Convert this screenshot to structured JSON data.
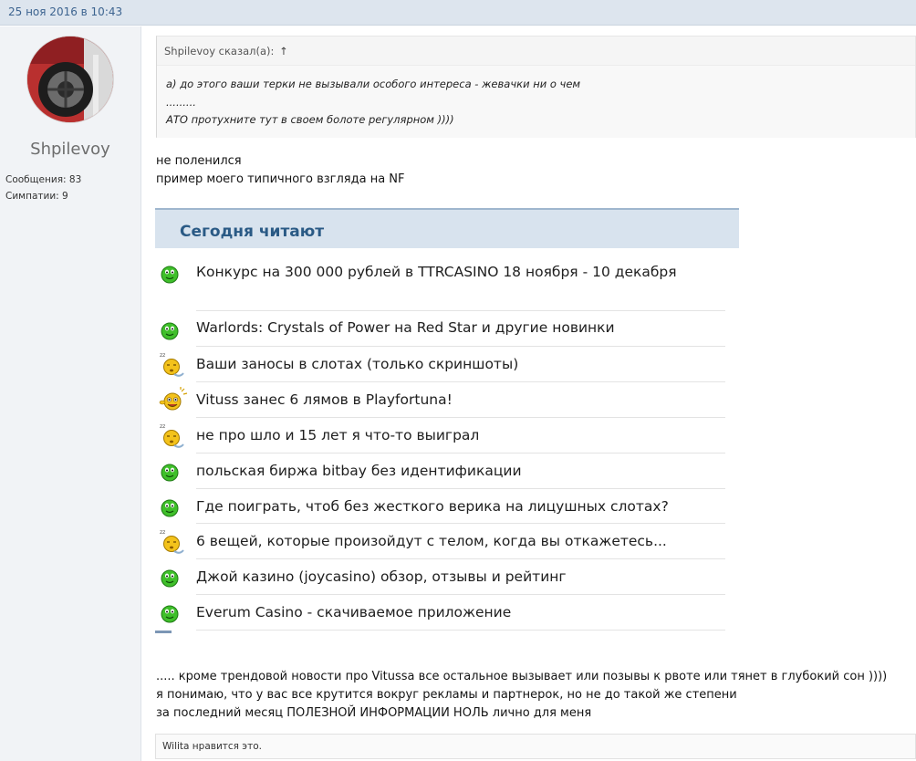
{
  "post": {
    "date": "25 ноя 2016 в 10:43"
  },
  "author": {
    "name": "Shpilevoy",
    "messages": "Сообщения: 83",
    "likes": "Симпатии: 9"
  },
  "quote": {
    "header": "Shpilevoy сказал(а):",
    "arrow": "↑",
    "lines": [
      "а) до этого ваши терки не вызывали особого интереса - жевачки ни о чем",
      ".........",
      "АТО протухните тут в своем болоте регулярном ))))"
    ]
  },
  "message": {
    "intro": [
      "не поленился",
      "пример моего типичного взгляда на NF"
    ],
    "outro": [
      "..... кроме трендовой новости про Vitussa все остальное вызывает или позывы к рвоте или тянет в глубокий сон ))))",
      "я понимаю, что у вас все крутится вокруг рекламы и партнерок, но не до такой же степени",
      "за последний месяц ПОЛЕЗНОЙ ИНФОРМАЦИИ НОЛЬ лично для меня"
    ]
  },
  "widget": {
    "title": "Сегодня читают",
    "items": [
      {
        "title": "Конкурс на 300 000 рублей в TTRCASINO 18 ноября - 10 декабря",
        "icon": "green-smiley-icon"
      },
      {
        "title": "Warlords: Crystals of Power на Red Star и другие новинки",
        "icon": "green-smiley-icon"
      },
      {
        "title": "Ваши заносы в слотах (только скриншоты)",
        "icon": "sleeping-smiley-icon"
      },
      {
        "title": "Vituss занес 6 лямов в Playfortuna!",
        "icon": "excited-smiley-icon"
      },
      {
        "title": "не про шло и 15 лет я что-то выиграл",
        "icon": "sleeping-smiley-icon"
      },
      {
        "title": "польская биржа bitbay без идентификации",
        "icon": "green-smiley-icon"
      },
      {
        "title": "Где поиграть, чтоб без жесткого верика на лицушных слотах?",
        "icon": "green-smiley-icon"
      },
      {
        "title": "6 вещей, которые произойдут с телом, когда вы откажетесь...",
        "icon": "sleeping-smiley-icon"
      },
      {
        "title": "Джой казино (joycasino) обзор, отзывы и рейтинг",
        "icon": "green-smiley-icon"
      },
      {
        "title": "Everum Casino - скачиваемое приложение",
        "icon": "green-smiley-icon"
      }
    ]
  },
  "likes": {
    "text": "Wilita нравится это."
  },
  "colors": {
    "accent": "#2a5a85",
    "header_bg": "#d8e3ee",
    "green": "#3fbf2a",
    "yellow": "#f3c21b"
  }
}
